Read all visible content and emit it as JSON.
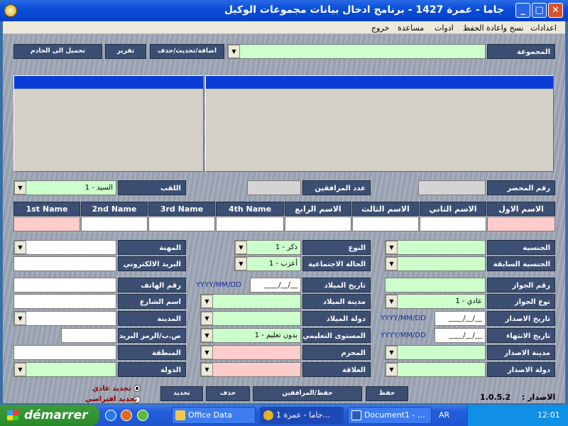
{
  "window": {
    "title": "جاما - عمرة 1427 - برنامج ادخال بيانات مجموعات الوكيل",
    "close_glyph": "✕",
    "max_glyph": "□",
    "min_glyph": "_"
  },
  "menu": {
    "items": [
      "اعدادات",
      "نسخ واعادة الحفظ",
      "ادوات",
      "مساعدة",
      "خروج"
    ]
  },
  "toolbar": {
    "group_label": "المجموعة",
    "group_value": "",
    "add_update_delete": "اضافة/تحديث/حذف",
    "report": "تقرير",
    "upload_server": "تحميل الى الخادم"
  },
  "row1": {
    "mahram_no_label": "رقم المحضر",
    "mahram_no_value": "",
    "companions_label": "عدد المرافقين",
    "companions_value": "",
    "title_label": "اللقب",
    "title_value": "السيد - 1"
  },
  "names": {
    "ar_headers": [
      "الاسم الاول",
      "الاسم الثاني",
      "الاسم الثالث",
      "الاسم الرابع"
    ],
    "en_headers": [
      "4th Name",
      "3rd Name",
      "2nd Name",
      "1st Name"
    ]
  },
  "form": {
    "nationality": "الجنسية",
    "prev_nationality": "الجنسية السابقة",
    "passport_no": "رقم الجواز",
    "passport_type": "نوع الجواز",
    "passport_type_value": "عادي - 1",
    "issue_date": "تاريخ الاصدار",
    "expiry_date": "تاريخ الانتهاء",
    "issue_city": "مدينة الاصدار",
    "issue_country": "دولة الاصدار",
    "gender": "النوع",
    "gender_value": "ذكر - 1",
    "marital": "الحالة الاجتماعية",
    "marital_value": "أعزب - 1",
    "birth_date": "تاريخ الميلاد",
    "birth_city": "مدينة الميلاد",
    "birth_country": "دولة الميلاد",
    "education": "المستوى التعليمي",
    "education_value": "بدون تعليم - 1",
    "mahram": "المحرم",
    "relation": "العلاقة",
    "profession": "المهنة",
    "email": "البريد الالكتروني",
    "phone": "رقم الهاتف",
    "street": "اسم الشارع",
    "city": "المدينة",
    "pobox": "ص.ب/الرمز البريدي",
    "region": "المنطقة",
    "country": "الدولة",
    "date_mask": "__/__/____",
    "date_hint": "YYYY/MM/DD"
  },
  "bottom": {
    "save": "حفظ",
    "save_companions": "حفظ/المرافقين",
    "delete": "حذف",
    "new": "تحديد",
    "radio_normal": "تجديد عادي",
    "radio_default": "تجديد افتراضي",
    "version_label": "الاصدار :",
    "version_value": "1.0.5.2"
  },
  "taskbar": {
    "start": "démarrer",
    "tasks": [
      "Office Data",
      "جاما - عمرة 1...",
      "Document1 - ..."
    ],
    "lang": "AR",
    "clock": "12:01"
  },
  "icons": {
    "dropdown": "▼",
    "start_logo": "windows-logo-icon",
    "folder": "folder-icon",
    "word": "word-icon",
    "app": "gama-app-icon"
  }
}
